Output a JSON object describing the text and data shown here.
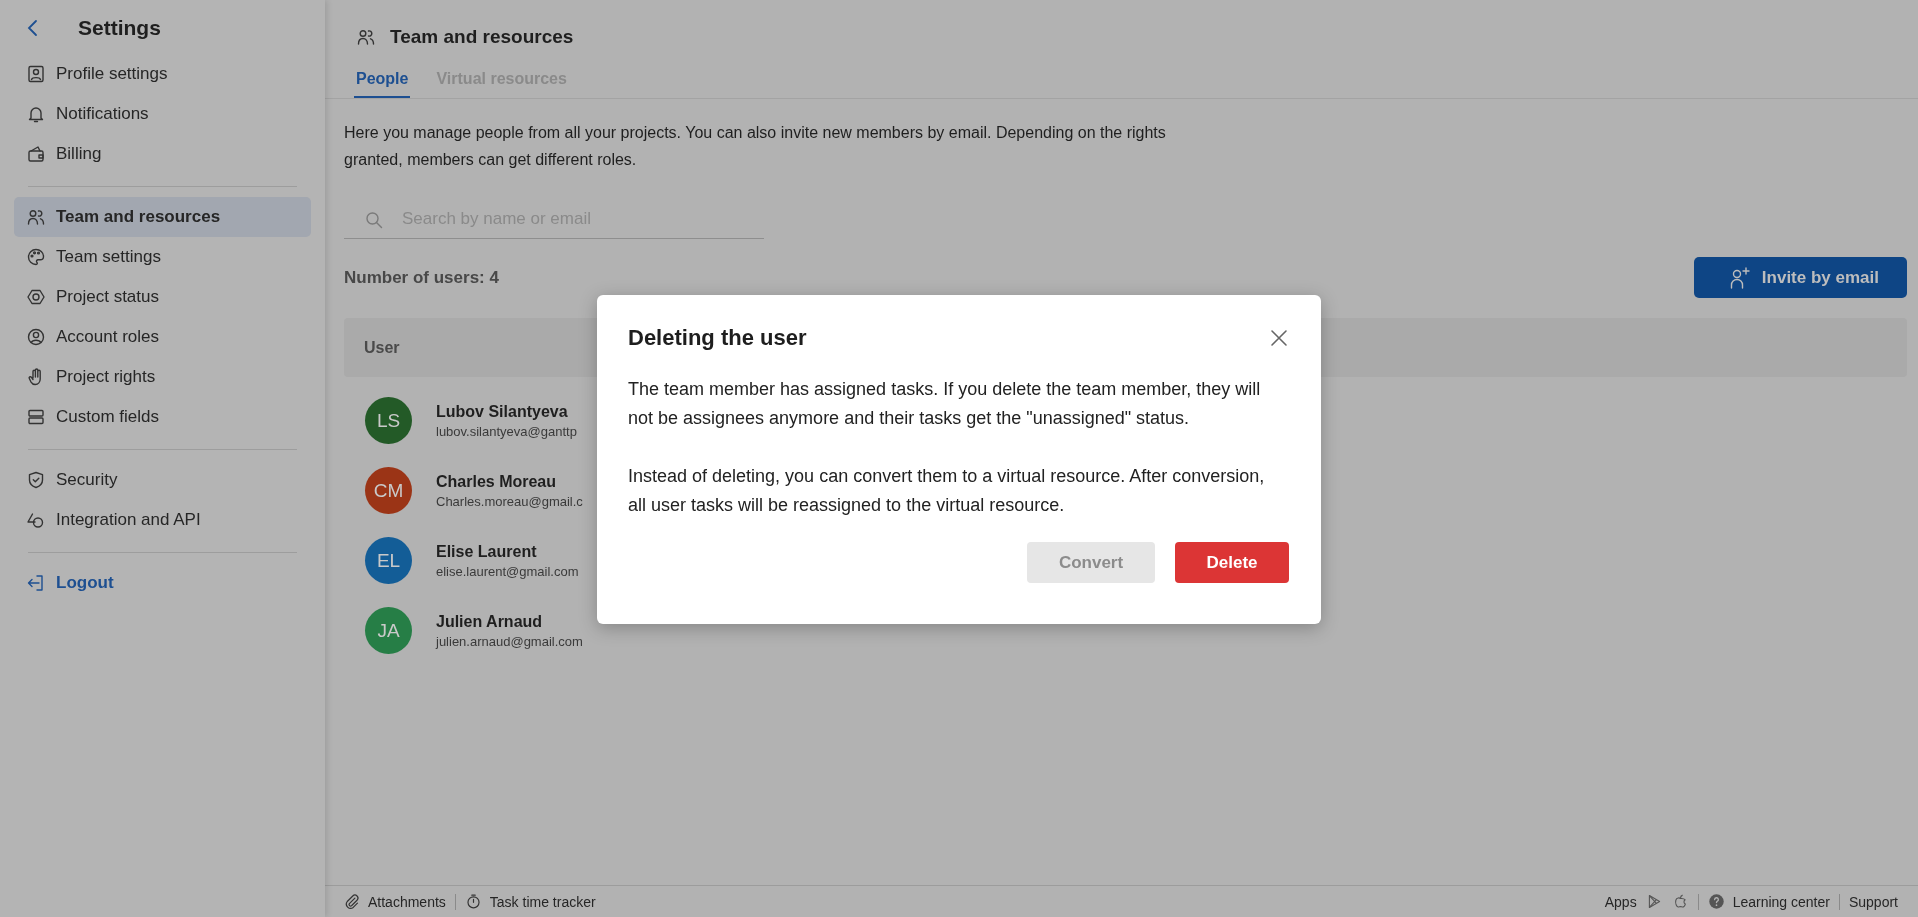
{
  "sidebar": {
    "title": "Settings",
    "groups": [
      [
        {
          "label": "Profile settings",
          "selected": false
        },
        {
          "label": "Notifications",
          "selected": false
        },
        {
          "label": "Billing",
          "selected": false
        }
      ],
      [
        {
          "label": "Team and resources",
          "selected": true
        },
        {
          "label": "Team settings",
          "selected": false
        },
        {
          "label": "Project status",
          "selected": false
        },
        {
          "label": "Account roles",
          "selected": false
        },
        {
          "label": "Project rights",
          "selected": false
        },
        {
          "label": "Custom fields",
          "selected": false
        }
      ],
      [
        {
          "label": "Security",
          "selected": false
        },
        {
          "label": "Integration and API",
          "selected": false
        }
      ]
    ],
    "logout": "Logout"
  },
  "header": {
    "title": "Team and resources"
  },
  "tabs": [
    {
      "label": "People",
      "selected": true
    },
    {
      "label": "Virtual resources",
      "selected": false
    }
  ],
  "description": "Here you manage people from all your projects. You can also invite new members by email. Depending on the rights granted, members can get different roles.",
  "search": {
    "placeholder": "Search by name or email"
  },
  "user_count": "Number of users: 4",
  "invite_button": "Invite by email",
  "table": {
    "columns": [
      "User"
    ],
    "rows": [
      {
        "initials": "LS",
        "name": "Lubov Silantyeva",
        "email": "lubov.silantyeva@ganttp",
        "color": "#235a27"
      },
      {
        "initials": "CM",
        "name": "Charles Moreau",
        "email": "Charles.moreau@gmail.c",
        "color": "#9b3416"
      },
      {
        "initials": "EL",
        "name": "Elise Laurent",
        "email": "elise.laurent@gmail.com",
        "color": "#135d97"
      },
      {
        "initials": "JA",
        "name": "Julien Arnaud",
        "email": "julien.arnaud@gmail.com",
        "color": "#267e46"
      }
    ]
  },
  "dialog": {
    "title": "Deleting the user",
    "paragraphs": [
      "The team member has assigned tasks. If you delete the team member, they will not be assignees anymore and their tasks get the \"unassigned\" status.",
      "Instead of deleting, you can convert them to a virtual resource. After conversion, all user tasks will be reassigned to the virtual resource."
    ],
    "buttons": [
      {
        "label": "Convert",
        "kind": "secondary"
      },
      {
        "label": "Delete",
        "kind": "danger"
      }
    ]
  },
  "footer": {
    "left": [
      {
        "label": "Attachments"
      },
      {
        "label": "Task time tracker"
      }
    ],
    "right": [
      {
        "label": "Apps"
      },
      {
        "label": "Learning center"
      },
      {
        "label": "Support"
      }
    ]
  }
}
